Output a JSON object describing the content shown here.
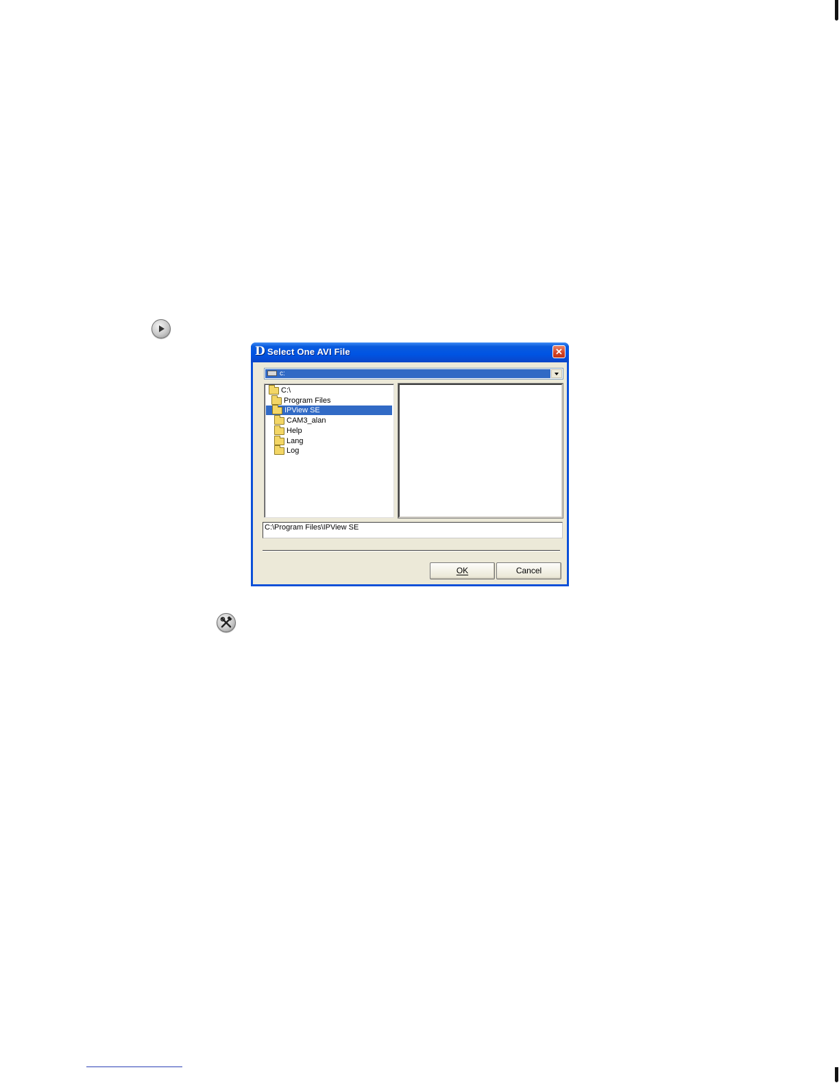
{
  "dialog": {
    "title": "Select One AVI File",
    "logo_letter": "D",
    "close_glyph": "✕",
    "drive": {
      "selected": "c:",
      "icon": "drive-icon"
    },
    "tree": [
      {
        "label": "C:\\",
        "icon": "folder-open-icon",
        "selected": false
      },
      {
        "label": "Program Files",
        "icon": "folder-open-icon",
        "selected": false
      },
      {
        "label": "IPView SE",
        "icon": "folder-open-icon",
        "selected": true
      },
      {
        "label": "CAM3_alan",
        "icon": "folder-icon",
        "selected": false
      },
      {
        "label": "Help",
        "icon": "folder-icon",
        "selected": false
      },
      {
        "label": "Lang",
        "icon": "folder-icon",
        "selected": false
      },
      {
        "label": "Log",
        "icon": "folder-icon",
        "selected": false
      }
    ],
    "path": "C:\\Program Files\\IPView SE",
    "ok_label": "OK",
    "cancel_label": "Cancel"
  },
  "icons": {
    "play": "play-icon",
    "tools": "tools-icon"
  },
  "colors": {
    "titlebar": "#0054e3",
    "selection": "#316ac5",
    "face": "#ece9d8"
  }
}
